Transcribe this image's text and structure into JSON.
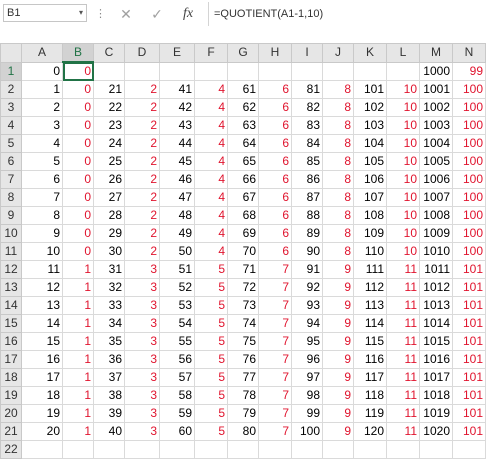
{
  "namebox": {
    "value": "B1"
  },
  "formula": {
    "text": "=QUOTIENT(A1-1,10)"
  },
  "icons": {
    "cancel": "✕",
    "enter": "✓",
    "fx": "fx",
    "more": "⋮",
    "dropdown": "▾"
  },
  "colors": {
    "accent": "#217346",
    "quotient_text": "#e0142e"
  },
  "columns": [
    "A",
    "B",
    "C",
    "D",
    "E",
    "F",
    "G",
    "H",
    "I",
    "J",
    "K",
    "L",
    "M",
    "N"
  ],
  "rows": [
    {
      "n": "1",
      "cells": [
        "0",
        "0",
        "",
        "",
        "",
        "",
        "",
        "",
        "",
        "",
        "",
        "",
        "1000",
        "99"
      ]
    },
    {
      "n": "2",
      "cells": [
        "1",
        "0",
        "21",
        "2",
        "41",
        "4",
        "61",
        "6",
        "81",
        "8",
        "101",
        "10",
        "1001",
        "100"
      ]
    },
    {
      "n": "3",
      "cells": [
        "2",
        "0",
        "22",
        "2",
        "42",
        "4",
        "62",
        "6",
        "82",
        "8",
        "102",
        "10",
        "1002",
        "100"
      ]
    },
    {
      "n": "4",
      "cells": [
        "3",
        "0",
        "23",
        "2",
        "43",
        "4",
        "63",
        "6",
        "83",
        "8",
        "103",
        "10",
        "1003",
        "100"
      ]
    },
    {
      "n": "5",
      "cells": [
        "4",
        "0",
        "24",
        "2",
        "44",
        "4",
        "64",
        "6",
        "84",
        "8",
        "104",
        "10",
        "1004",
        "100"
      ]
    },
    {
      "n": "6",
      "cells": [
        "5",
        "0",
        "25",
        "2",
        "45",
        "4",
        "65",
        "6",
        "85",
        "8",
        "105",
        "10",
        "1005",
        "100"
      ]
    },
    {
      "n": "7",
      "cells": [
        "6",
        "0",
        "26",
        "2",
        "46",
        "4",
        "66",
        "6",
        "86",
        "8",
        "106",
        "10",
        "1006",
        "100"
      ]
    },
    {
      "n": "8",
      "cells": [
        "7",
        "0",
        "27",
        "2",
        "47",
        "4",
        "67",
        "6",
        "87",
        "8",
        "107",
        "10",
        "1007",
        "100"
      ]
    },
    {
      "n": "9",
      "cells": [
        "8",
        "0",
        "28",
        "2",
        "48",
        "4",
        "68",
        "6",
        "88",
        "8",
        "108",
        "10",
        "1008",
        "100"
      ]
    },
    {
      "n": "10",
      "cells": [
        "9",
        "0",
        "29",
        "2",
        "49",
        "4",
        "69",
        "6",
        "89",
        "8",
        "109",
        "10",
        "1009",
        "100"
      ]
    },
    {
      "n": "11",
      "cells": [
        "10",
        "0",
        "30",
        "2",
        "50",
        "4",
        "70",
        "6",
        "90",
        "8",
        "110",
        "10",
        "1010",
        "100"
      ]
    },
    {
      "n": "12",
      "cells": [
        "11",
        "1",
        "31",
        "3",
        "51",
        "5",
        "71",
        "7",
        "91",
        "9",
        "111",
        "11",
        "1011",
        "101"
      ]
    },
    {
      "n": "13",
      "cells": [
        "12",
        "1",
        "32",
        "3",
        "52",
        "5",
        "72",
        "7",
        "92",
        "9",
        "112",
        "11",
        "1012",
        "101"
      ]
    },
    {
      "n": "14",
      "cells": [
        "13",
        "1",
        "33",
        "3",
        "53",
        "5",
        "73",
        "7",
        "93",
        "9",
        "113",
        "11",
        "1013",
        "101"
      ]
    },
    {
      "n": "15",
      "cells": [
        "14",
        "1",
        "34",
        "3",
        "54",
        "5",
        "74",
        "7",
        "94",
        "9",
        "114",
        "11",
        "1014",
        "101"
      ]
    },
    {
      "n": "16",
      "cells": [
        "15",
        "1",
        "35",
        "3",
        "55",
        "5",
        "75",
        "7",
        "95",
        "9",
        "115",
        "11",
        "1015",
        "101"
      ]
    },
    {
      "n": "17",
      "cells": [
        "16",
        "1",
        "36",
        "3",
        "56",
        "5",
        "76",
        "7",
        "96",
        "9",
        "116",
        "11",
        "1016",
        "101"
      ]
    },
    {
      "n": "18",
      "cells": [
        "17",
        "1",
        "37",
        "3",
        "57",
        "5",
        "77",
        "7",
        "97",
        "9",
        "117",
        "11",
        "1017",
        "101"
      ]
    },
    {
      "n": "19",
      "cells": [
        "18",
        "1",
        "38",
        "3",
        "58",
        "5",
        "78",
        "7",
        "98",
        "9",
        "118",
        "11",
        "1018",
        "101"
      ]
    },
    {
      "n": "20",
      "cells": [
        "19",
        "1",
        "39",
        "3",
        "59",
        "5",
        "79",
        "7",
        "99",
        "9",
        "119",
        "11",
        "1019",
        "101"
      ]
    },
    {
      "n": "21",
      "cells": [
        "20",
        "1",
        "40",
        "3",
        "60",
        "5",
        "80",
        "7",
        "100",
        "9",
        "120",
        "11",
        "1020",
        "101"
      ]
    }
  ],
  "partial_row": {
    "n": "22"
  }
}
